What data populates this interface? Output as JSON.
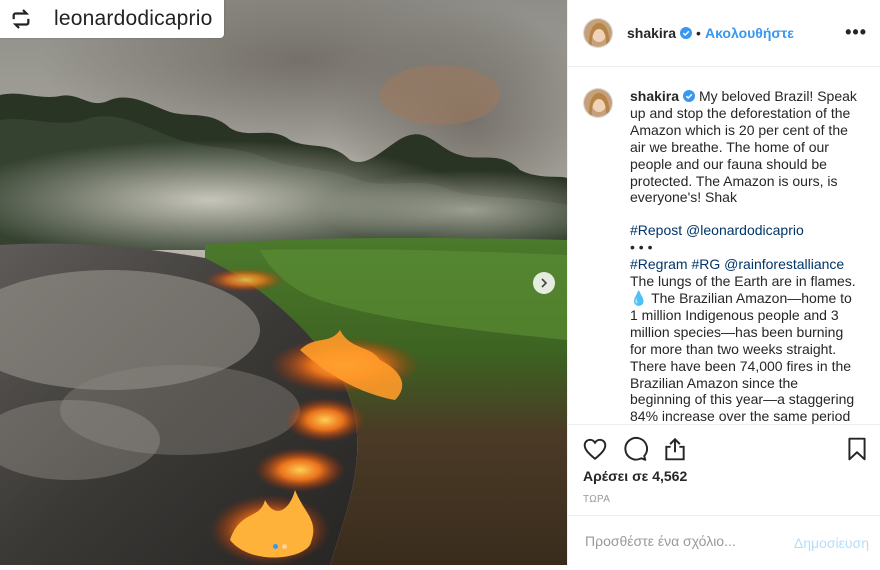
{
  "repost_banner": {
    "icon": "repost-icon",
    "username": "leonardodicaprio"
  },
  "header": {
    "username": "shakira",
    "verified_icon": "verified-badge-icon",
    "separator": "•",
    "follow_label": "Ακολουθήστε",
    "more_label": "•••"
  },
  "caption": {
    "username": "shakira",
    "text1": "My beloved Brazil! Speak up and stop the deforestation of the Amazon which is 20 per cent of the air we breathe. The home of our people and our fauna should be protected. The Amazon is ours, is everyone's! Shak",
    "repost_tag": "#Repost",
    "repost_mention": "@leonardodicaprio",
    "dots": "• • •",
    "regram_tag": "#Regram",
    "rg_tag": "#RG",
    "regram_mention": "@rainforestalliance",
    "text2": "The lungs of the Earth are in flames. 💧 The Brazilian Amazon—home to 1 million Indigenous people and 3 million species—has been burning for more than two weeks straight. There have been 74,000 fires in the Brazilian Amazon since the beginning of this year—a staggering 84% increase over the same period last year (National"
  },
  "actions": {
    "like_icon": "heart-icon",
    "comment_icon": "comment-icon",
    "share_icon": "share-icon",
    "save_icon": "bookmark-icon",
    "likes": "Αρέσει σε 4,562",
    "time": "ΤΩΡΑ"
  },
  "comment": {
    "placeholder": "Προσθέστε ένα σχόλιο...",
    "post_label": "Δημοσίευση"
  },
  "carousel": {
    "total": 2,
    "active": 1
  },
  "colors": {
    "link": "#003569",
    "accent": "#3897f0",
    "post_disabled": "#b2dffc",
    "muted": "#999999"
  }
}
